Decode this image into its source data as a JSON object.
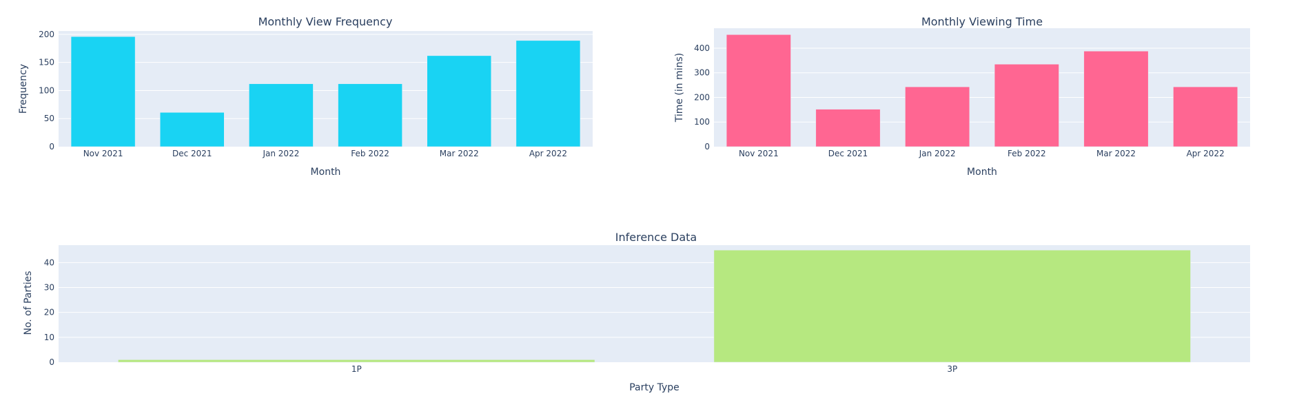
{
  "chart_data": [
    {
      "type": "bar",
      "title": "Monthly View Frequency",
      "xlabel": "Month",
      "ylabel": "Frequency",
      "categories": [
        "Nov 2021",
        "Dec 2021",
        "Jan 2022",
        "Feb 2022",
        "Mar 2022",
        "Apr 2022"
      ],
      "values": [
        196,
        61,
        112,
        112,
        162,
        189
      ],
      "ylim": [
        0,
        206
      ],
      "yticks": [
        0,
        50,
        100,
        150,
        200
      ],
      "color": "#19d3f3",
      "grid": true
    },
    {
      "type": "bar",
      "title": "Monthly Viewing Time",
      "xlabel": "Month",
      "ylabel": "Time (in mins)",
      "categories": [
        "Nov 2021",
        "Dec 2021",
        "Jan 2022",
        "Feb 2022",
        "Mar 2022",
        "Apr 2022"
      ],
      "values": [
        455,
        152,
        243,
        335,
        388,
        243
      ],
      "ylim": [
        0,
        481
      ],
      "yticks": [
        0,
        100,
        200,
        300,
        400
      ],
      "color": "#ff6692",
      "grid": true
    },
    {
      "type": "bar",
      "title": "Inference Data",
      "xlabel": "Party Type",
      "ylabel": "No. of Parties",
      "categories": [
        "1P",
        "3P"
      ],
      "values": [
        1,
        45
      ],
      "ylim": [
        0,
        47
      ],
      "yticks": [
        0,
        10,
        20,
        30,
        40
      ],
      "color": "#b6e880",
      "grid": true
    }
  ],
  "colors": {
    "plot_background": "#e5ecf6",
    "gridline": "#ffffff",
    "text": "#2a3f5f"
  }
}
